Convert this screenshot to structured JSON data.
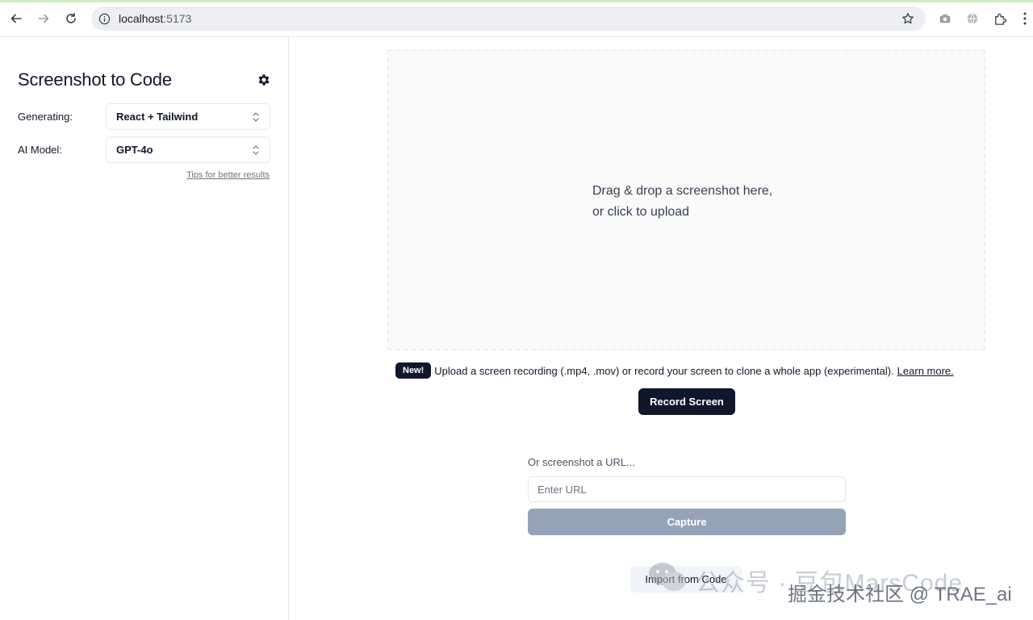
{
  "browser": {
    "url_host": "localhost",
    "url_port": ":5173"
  },
  "sidebar": {
    "title": "Screenshot to Code",
    "generating_label": "Generating:",
    "generating_value": "React + Tailwind",
    "model_label": "AI Model:",
    "model_value": "GPT-4o",
    "tips_link": "Tips for better results"
  },
  "main": {
    "dropzone_line1": "Drag & drop a screenshot here,",
    "dropzone_line2": "or click to upload",
    "badge": "New!",
    "notice_text": "Upload a screen recording (.mp4, .mov) or record your screen to clone a whole app (experimental).",
    "learn_more": "Learn more.",
    "record_button": "Record Screen",
    "url_label": "Or screenshot a URL...",
    "url_placeholder": "Enter URL",
    "capture_button": "Capture",
    "import_button": "Import from Code"
  },
  "watermark": {
    "line1": "公众号 · 豆包MarsCode",
    "line2": "掘金技术社区 @ TRAE_ai"
  },
  "colors": {
    "primary": "#0f172a",
    "capture_disabled": "#94a3b8",
    "border": "#e5e7eb"
  }
}
